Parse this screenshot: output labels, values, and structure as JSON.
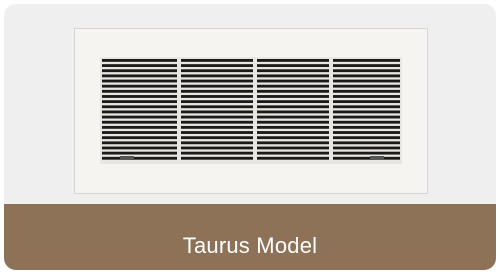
{
  "product": {
    "name": "Taurus Model",
    "image_icon": "air-vent-grille-icon"
  },
  "colors": {
    "card_background": "#efefef",
    "label_background": "#8d7257",
    "label_text": "#ffffff",
    "grille_frame": "#f6f4f1",
    "grille_slats": "#1a1a1a"
  }
}
